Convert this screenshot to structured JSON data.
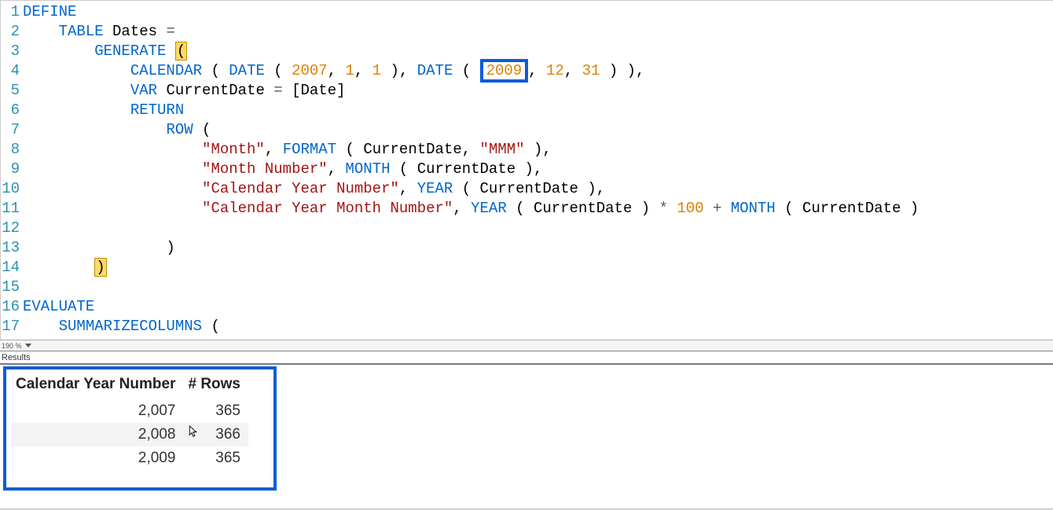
{
  "editor": {
    "zoom_text": "190 %",
    "line_count": 17,
    "tokens": [
      [
        {
          "t": "DEFINE",
          "c": "kw"
        }
      ],
      [
        {
          "t": "    ",
          "c": ""
        },
        {
          "t": "TABLE",
          "c": "kw"
        },
        {
          "t": " Dates ",
          "c": ""
        },
        {
          "t": "=",
          "c": "op"
        }
      ],
      [
        {
          "t": "        ",
          "c": ""
        },
        {
          "t": "GENERATE",
          "c": "kw"
        },
        {
          "t": " ",
          "c": ""
        },
        {
          "t": "(",
          "c": "hl-bracket"
        }
      ],
      [
        {
          "t": "            ",
          "c": ""
        },
        {
          "t": "CALENDAR",
          "c": "kw"
        },
        {
          "t": " ( ",
          "c": ""
        },
        {
          "t": "DATE",
          "c": "kw"
        },
        {
          "t": " ( ",
          "c": ""
        },
        {
          "t": "2007",
          "c": "num"
        },
        {
          "t": ", ",
          "c": ""
        },
        {
          "t": "1",
          "c": "num"
        },
        {
          "t": ", ",
          "c": ""
        },
        {
          "t": "1",
          "c": "num"
        },
        {
          "t": " ), ",
          "c": ""
        },
        {
          "t": "DATE",
          "c": "kw"
        },
        {
          "t": " ( ",
          "c": ""
        },
        {
          "wrap": "box"
        },
        {
          "t": "2009",
          "c": "num"
        },
        {
          "endwrap": true
        },
        {
          "t": ", ",
          "c": ""
        },
        {
          "t": "12",
          "c": "num"
        },
        {
          "t": ", ",
          "c": ""
        },
        {
          "t": "31",
          "c": "num"
        },
        {
          "t": " ) ),",
          "c": ""
        }
      ],
      [
        {
          "t": "            ",
          "c": ""
        },
        {
          "t": "VAR",
          "c": "kw"
        },
        {
          "t": " CurrentDate ",
          "c": ""
        },
        {
          "t": "=",
          "c": "op"
        },
        {
          "t": " [Date]",
          "c": ""
        }
      ],
      [
        {
          "t": "            ",
          "c": ""
        },
        {
          "t": "RETURN",
          "c": "kw"
        }
      ],
      [
        {
          "t": "                ",
          "c": ""
        },
        {
          "t": "ROW",
          "c": "kw"
        },
        {
          "t": " (",
          "c": ""
        }
      ],
      [
        {
          "t": "                    ",
          "c": ""
        },
        {
          "t": "\"Month\"",
          "c": "str"
        },
        {
          "t": ", ",
          "c": ""
        },
        {
          "t": "FORMAT",
          "c": "kw"
        },
        {
          "t": " ( CurrentDate, ",
          "c": ""
        },
        {
          "t": "\"MMM\"",
          "c": "str"
        },
        {
          "t": " ),",
          "c": ""
        }
      ],
      [
        {
          "t": "                    ",
          "c": ""
        },
        {
          "t": "\"Month Number\"",
          "c": "str"
        },
        {
          "t": ", ",
          "c": ""
        },
        {
          "t": "MONTH",
          "c": "kw"
        },
        {
          "t": " ( CurrentDate ),",
          "c": ""
        }
      ],
      [
        {
          "t": "                    ",
          "c": ""
        },
        {
          "t": "\"Calendar Year Number\"",
          "c": "str"
        },
        {
          "t": ", ",
          "c": ""
        },
        {
          "t": "YEAR",
          "c": "kw"
        },
        {
          "t": " ( CurrentDate ),",
          "c": ""
        }
      ],
      [
        {
          "t": "                    ",
          "c": ""
        },
        {
          "t": "\"Calendar Year Month Number\"",
          "c": "str"
        },
        {
          "t": ", ",
          "c": ""
        },
        {
          "t": "YEAR",
          "c": "kw"
        },
        {
          "t": " ( CurrentDate ) ",
          "c": ""
        },
        {
          "t": "*",
          "c": "op"
        },
        {
          "t": " ",
          "c": ""
        },
        {
          "t": "100",
          "c": "num"
        },
        {
          "t": " ",
          "c": ""
        },
        {
          "t": "+",
          "c": "op"
        },
        {
          "t": " ",
          "c": ""
        },
        {
          "t": "MONTH",
          "c": "kw"
        },
        {
          "t": " ( CurrentDate )",
          "c": ""
        }
      ],
      [],
      [
        {
          "t": "                )",
          "c": ""
        }
      ],
      [
        {
          "t": "        ",
          "c": ""
        },
        {
          "t": ")",
          "c": "hl-bracket"
        }
      ],
      [],
      [
        {
          "t": "EVALUATE",
          "c": "kw"
        }
      ],
      [
        {
          "t": "    ",
          "c": ""
        },
        {
          "t": "SUMMARIZECOLUMNS",
          "c": "kw"
        },
        {
          "t": " (",
          "c": ""
        }
      ]
    ]
  },
  "results": {
    "label": "Results",
    "headers": [
      "Calendar Year Number",
      "# Rows"
    ],
    "rows": [
      [
        "2,007",
        "365"
      ],
      [
        "2,008",
        "366"
      ],
      [
        "2,009",
        "365"
      ]
    ]
  }
}
